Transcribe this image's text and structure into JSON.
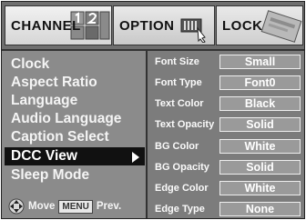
{
  "tabs": [
    {
      "label": "CHANNEL",
      "decor_icon": "channel-numbers-icon"
    },
    {
      "label": "OPTION",
      "decor_icon": "option-hand-icon"
    },
    {
      "label": "LOCK",
      "decor_icon": "lock-card-icon"
    }
  ],
  "menu": {
    "items": [
      {
        "label": "Clock"
      },
      {
        "label": "Aspect Ratio"
      },
      {
        "label": "Language"
      },
      {
        "label": "Audio Language"
      },
      {
        "label": "Caption Select"
      },
      {
        "label": "DCC View",
        "selected": true
      },
      {
        "label": "Sleep Mode"
      }
    ]
  },
  "settings": [
    {
      "label": "Font Size",
      "value": "Small"
    },
    {
      "label": "Font Type",
      "value": "Font0"
    },
    {
      "label": "Text Color",
      "value": "Black"
    },
    {
      "label": "Text Opacity",
      "value": "Solid"
    },
    {
      "label": "BG Color",
      "value": "White"
    },
    {
      "label": "BG Opacity",
      "value": "Solid"
    },
    {
      "label": "Edge Color",
      "value": "White"
    },
    {
      "label": "Edge Type",
      "value": "None"
    }
  ],
  "legend": {
    "nav_icon": "dpad-icon",
    "move_label": "Move",
    "menu_key": "MENU",
    "prev_label": "Prev."
  },
  "colors": {
    "screen_bg": "#8b8b8b",
    "selected_bg": "#111111",
    "panel_bg": "#7c7c7c",
    "value_box_border": "#eeeeee"
  }
}
